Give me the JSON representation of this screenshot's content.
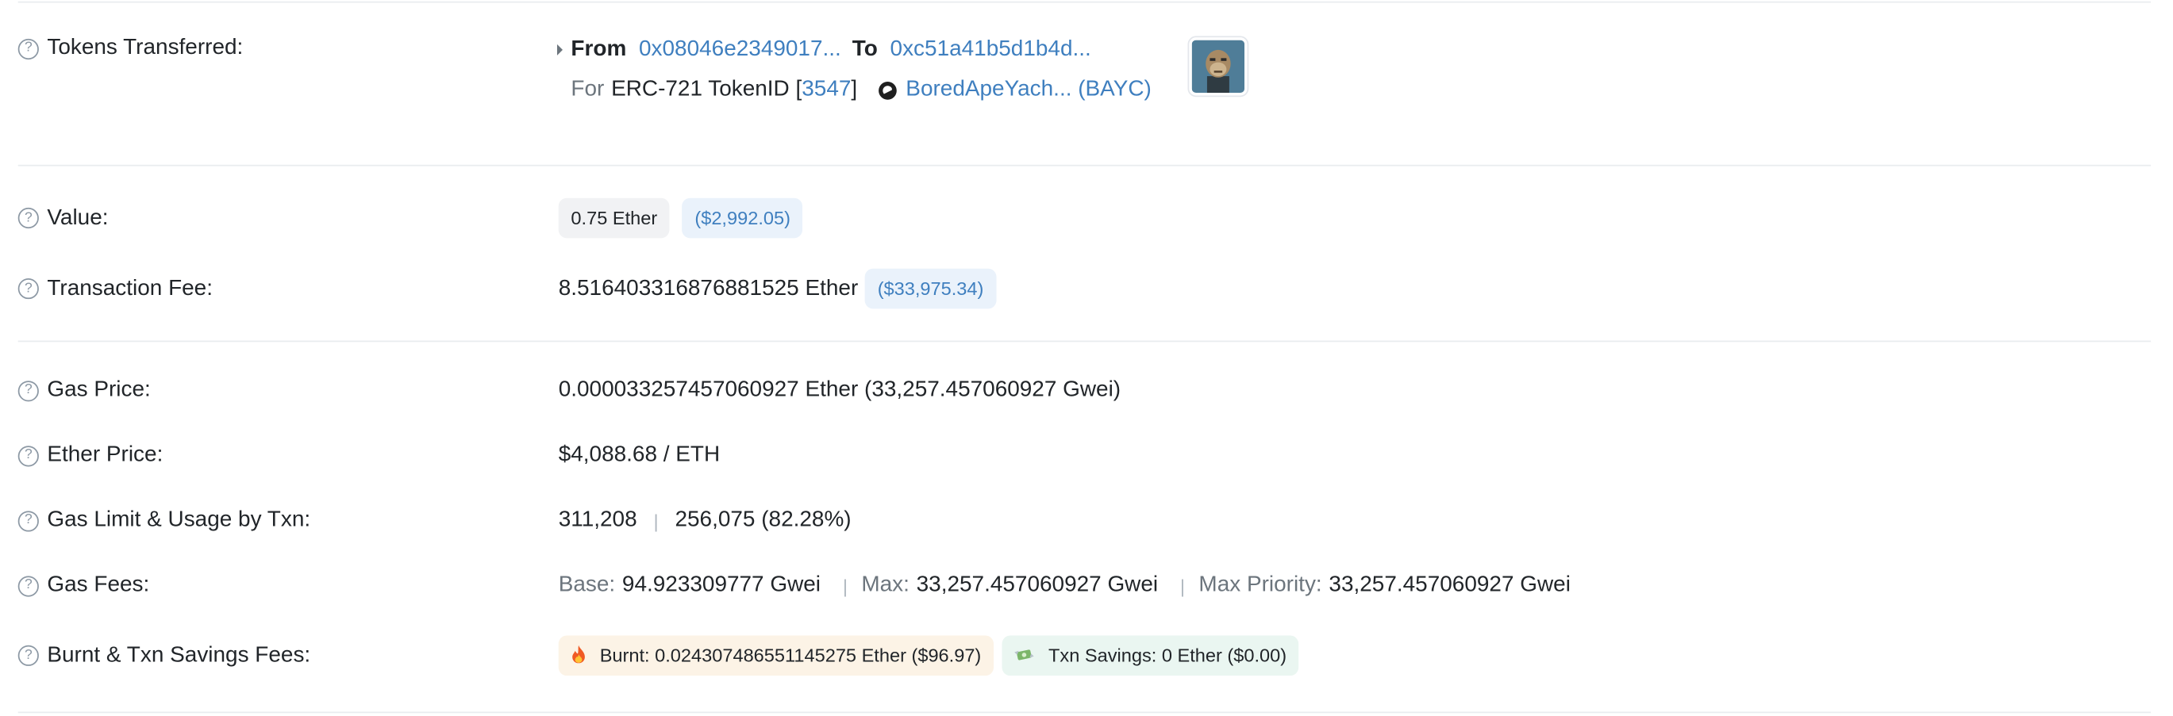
{
  "tokens_transferred": {
    "label": "Tokens Transferred:",
    "from_label": "From",
    "from_address": "0x08046e2349017...",
    "to_label": "To",
    "to_address": "0xc51a41b5d1b4d...",
    "for_label": "For",
    "token_standard": "ERC-721 TokenID [",
    "token_id": "3547",
    "bracket_close": "]",
    "token_name": "BoredApeYach... (BAYC)",
    "token_icon": "bayc-token-icon",
    "nft_image": "bored-ape-nft-thumbnail"
  },
  "value": {
    "label": "Value:",
    "ether": "0.75 Ether",
    "usd": "($2,992.05)"
  },
  "transaction_fee": {
    "label": "Transaction Fee:",
    "ether": "8.516403316876881525 Ether",
    "usd": "($33,975.34)"
  },
  "gas_price": {
    "label": "Gas Price:",
    "value": "0.000033257457060927 Ether (33,257.457060927 Gwei)"
  },
  "ether_price": {
    "label": "Ether Price:",
    "value": "$4,088.68 / ETH"
  },
  "gas_limit": {
    "label": "Gas Limit & Usage by Txn:",
    "limit": "311,208",
    "separator": "|",
    "usage": "256,075 (82.28%)"
  },
  "gas_fees": {
    "label": "Gas Fees:",
    "base_label": "Base:",
    "base_value": "94.923309777 Gwei",
    "max_label": "Max:",
    "max_value": "33,257.457060927 Gwei",
    "max_priority_label": "Max Priority:",
    "max_priority_value": "33,257.457060927 Gwei",
    "separator": "|"
  },
  "burnt_fees": {
    "label": "Burnt & Txn Savings Fees:",
    "burnt": "Burnt: 0.024307486551145275 Ether ($96.97)",
    "burnt_icon": "fire-icon",
    "savings": "Txn Savings: 0 Ether ($0.00)",
    "savings_icon": "money-wings-icon"
  },
  "help_icon_glyph": "?"
}
